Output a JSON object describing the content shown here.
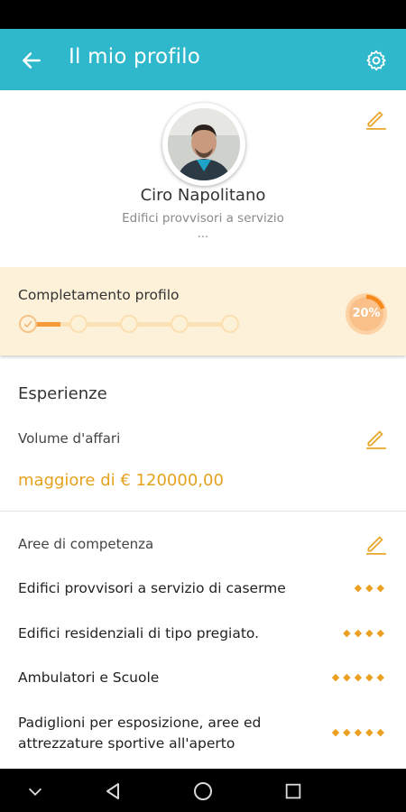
{
  "app_bar": {
    "title": "Il mio profilo",
    "back_icon": "arrow-left-icon",
    "settings_icon": "gear-icon",
    "background": "#2fb8cb"
  },
  "profile": {
    "name": "Ciro Napolitano",
    "subtitle": "Edifici provvisori a servizio",
    "more": "..."
  },
  "completion": {
    "title": "Completamento profilo",
    "percent_label": "20%",
    "percent": 20,
    "steps_total": 5,
    "steps_done": 1,
    "accent": "#f79a3a"
  },
  "experience": {
    "section_title": "Esperienze",
    "turnover_label": "Volume d'affari",
    "turnover_value": "maggiore di € 120000,00",
    "areas_label": "Aree di competenza",
    "areas": [
      {
        "label": "Edifici provvisori a servizio di caserme",
        "rating": 3
      },
      {
        "label": "Edifici residenziali di tipo pregiato.",
        "rating": 4
      },
      {
        "label": "Ambulatori e Scuole",
        "rating": 5
      },
      {
        "label": "Padiglioni per esposizione, aree ed attrezzature sportive all'aperto",
        "rating": 5
      }
    ],
    "value_color": "#e5a21e"
  },
  "nav_bar": {
    "icons": [
      "chevron-down-icon",
      "back-triangle-icon",
      "home-circle-icon",
      "recents-square-icon"
    ]
  }
}
